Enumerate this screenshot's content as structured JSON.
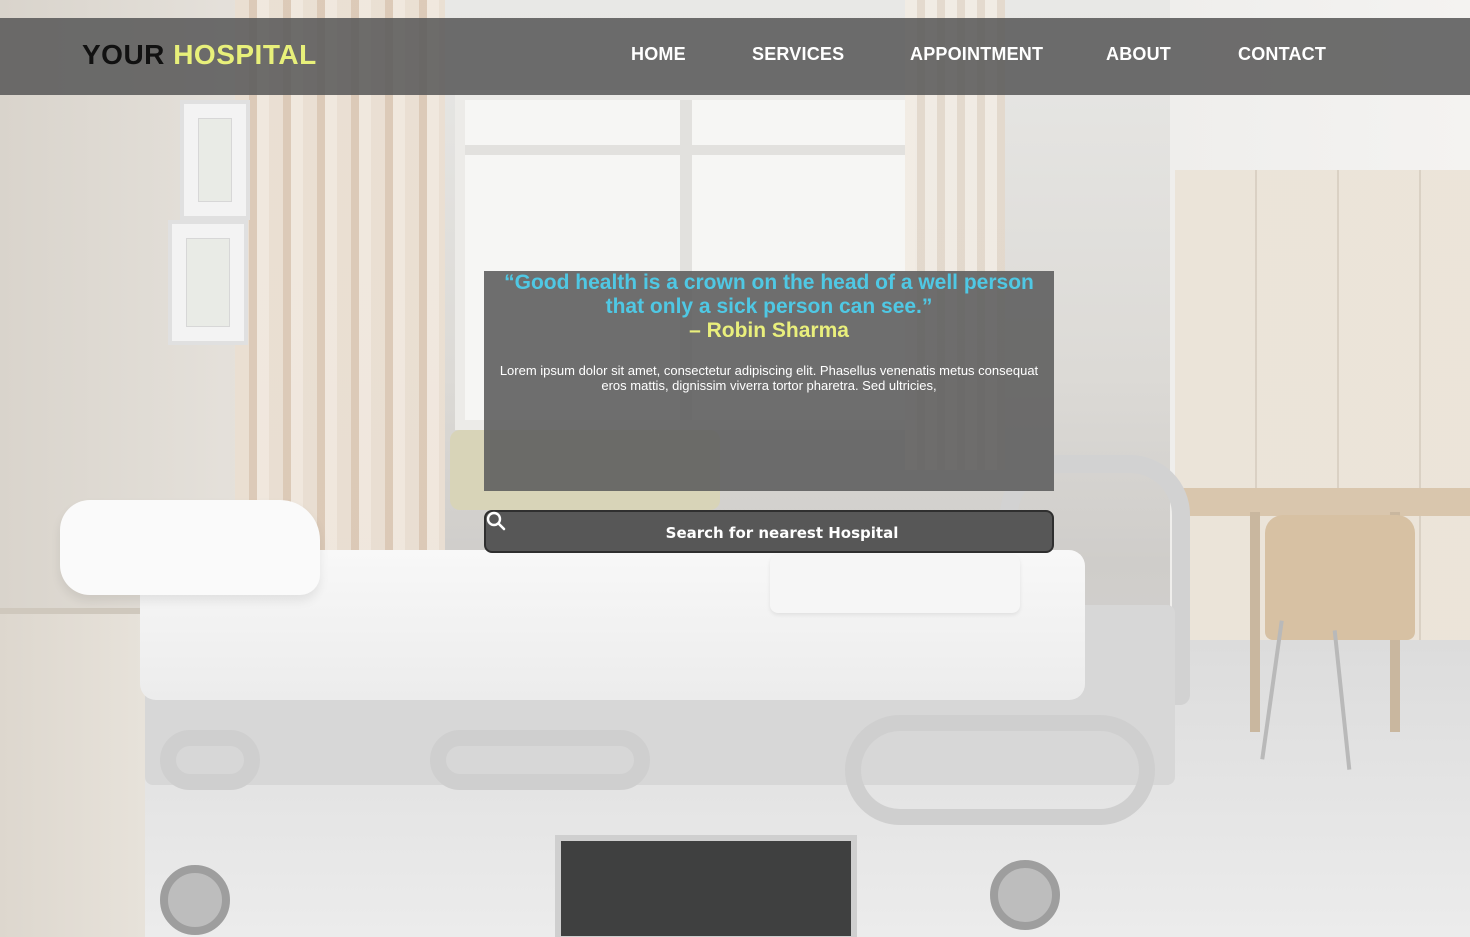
{
  "brand": {
    "part1": "YOUR",
    "part2": "HOSPITAL"
  },
  "nav": {
    "items": [
      {
        "label": "HOME"
      },
      {
        "label": "SERVICES"
      },
      {
        "label": "APPOINTMENT"
      },
      {
        "label": "ABOUT"
      },
      {
        "label": "CONTACT"
      }
    ]
  },
  "hero": {
    "quote_line1": "“Good health is a crown on the head of a well person",
    "quote_line2": "that only a sick person can see.”",
    "author": "– Robin Sharma",
    "body": "Lorem ipsum dolor sit amet, consectetur adipiscing elit. Phasellus venenatis metus consequat eros mattis, dignissim viverra tortor pharetra. Sed ultricies,"
  },
  "search": {
    "placeholder": "Search for nearest Hospital",
    "icon": "search-icon"
  },
  "colors": {
    "brand_accent": "#e8f07a",
    "quote_color": "#4fc8e4",
    "author_color": "#e9ef7c",
    "header_bg": "#5a5a5a"
  }
}
